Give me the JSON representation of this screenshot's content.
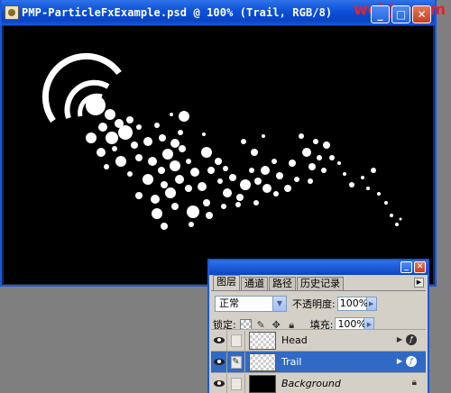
{
  "window": {
    "title": "PMP-ParticleFxExample.psd @ 100% (Trail, RGB/8)",
    "watermark": "webjx.com",
    "buttons": {
      "minimize": "_",
      "maximize": "□",
      "close": "✕"
    }
  },
  "palette": {
    "tabs": [
      "图层",
      "通道",
      "路径",
      "历史记录"
    ],
    "active_tab": "图层",
    "blend_mode": "正常",
    "opacity_label": "不透明度:",
    "opacity_value": "100%",
    "lock_label": "锁定:",
    "fill_label": "填充:",
    "fill_value": "100%",
    "layers": [
      {
        "name": "Head",
        "visible": true,
        "selected": false,
        "has_fx": true
      },
      {
        "name": "Trail",
        "visible": true,
        "selected": true,
        "has_fx": true
      },
      {
        "name": "Background",
        "visible": true,
        "selected": false,
        "locked": true
      }
    ]
  },
  "colors": {
    "titlebar": "#0b4fd8",
    "canvas": "#000000",
    "selection": "#316ac5",
    "watermark": "#e8202a"
  },
  "icons": {
    "app": "photoshop-document-icon",
    "eye": "eye-icon",
    "brush": "brush-icon",
    "fx": "layer-effects-icon",
    "lock": "lock-icon"
  }
}
